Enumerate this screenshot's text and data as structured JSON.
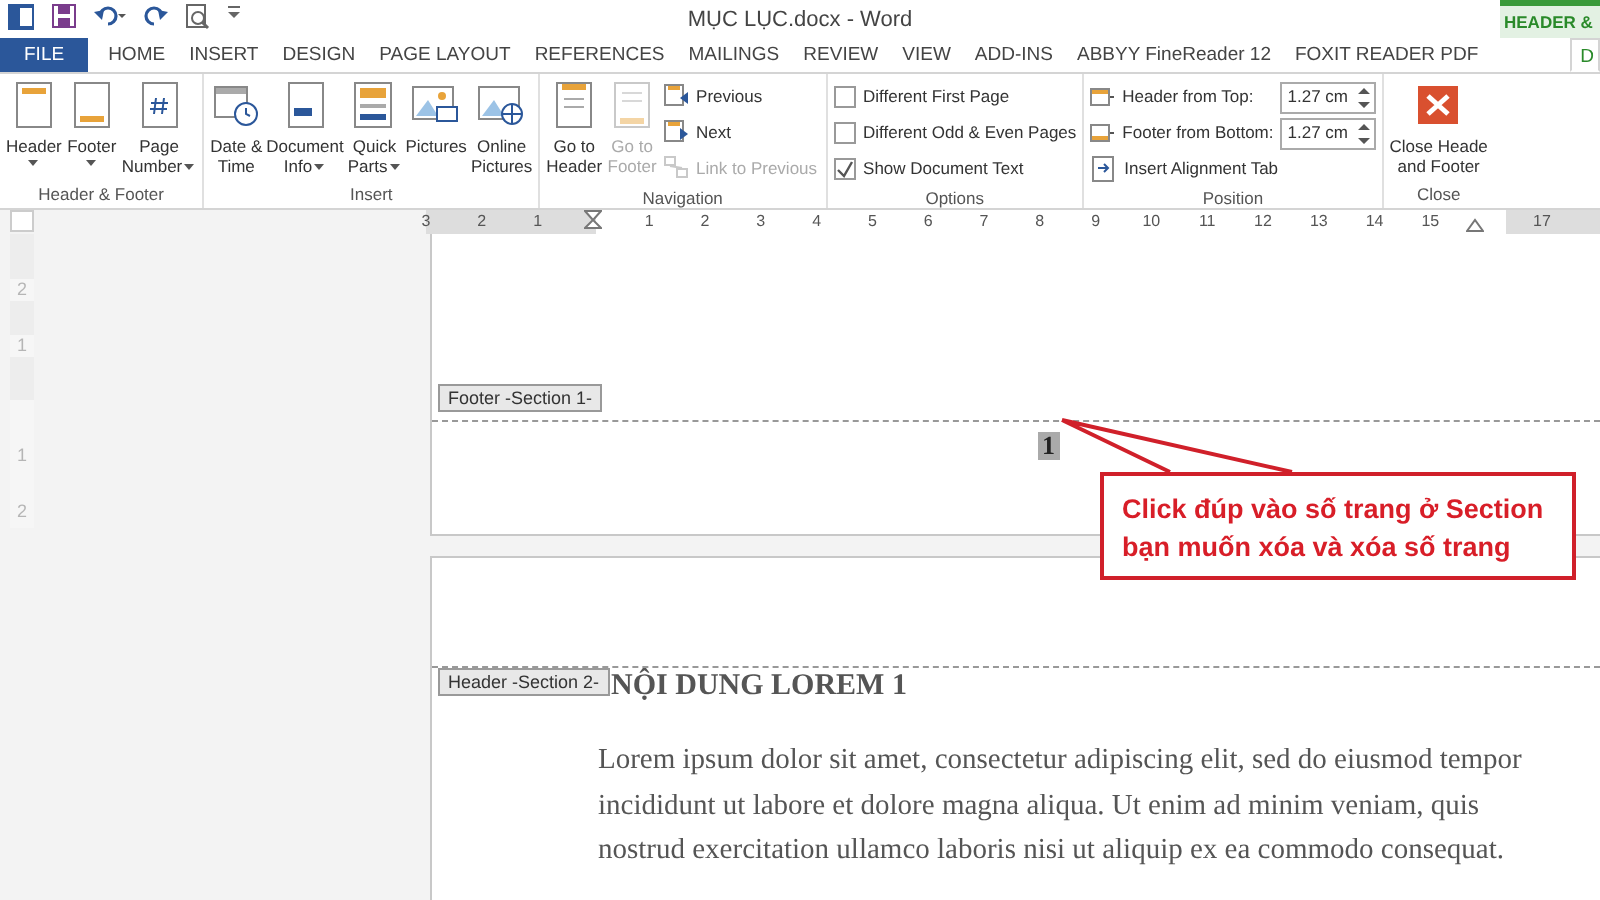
{
  "title_bar": {
    "title": "MỤC LỤC.docx - Word",
    "context_label": "HEADER &"
  },
  "tabs": [
    {
      "label": "FILE",
      "kind": "file",
      "selected": false
    },
    {
      "label": "HOME",
      "kind": "plain",
      "selected": false
    },
    {
      "label": "INSERT",
      "kind": "plain",
      "selected": false
    },
    {
      "label": "DESIGN",
      "kind": "plain",
      "selected": false
    },
    {
      "label": "PAGE LAYOUT",
      "kind": "plain",
      "selected": false
    },
    {
      "label": "REFERENCES",
      "kind": "plain",
      "selected": false
    },
    {
      "label": "MAILINGS",
      "kind": "plain",
      "selected": false
    },
    {
      "label": "REVIEW",
      "kind": "plain",
      "selected": false
    },
    {
      "label": "VIEW",
      "kind": "plain",
      "selected": false
    },
    {
      "label": "ADD-INS",
      "kind": "plain",
      "selected": false
    },
    {
      "label": "ABBYY FineReader 12",
      "kind": "plain",
      "selected": false
    },
    {
      "label": "FOXIT READER PDF",
      "kind": "plain",
      "selected": false
    },
    {
      "label": "D",
      "kind": "context",
      "selected": true
    }
  ],
  "ribbon": [
    {
      "label": "Header & Footer",
      "items": [
        {
          "kind": "large",
          "lines": [
            "Header"
          ],
          "dropdown": true,
          "disabled": false
        },
        {
          "kind": "large",
          "lines": [
            "Footer"
          ],
          "dropdown": true,
          "disabled": false
        },
        {
          "kind": "large",
          "lines": [
            "Page",
            "Number"
          ],
          "dropdown": true,
          "disabled": false
        }
      ]
    },
    {
      "label": "Insert",
      "items": [
        {
          "kind": "large",
          "lines": [
            "Date &",
            "Time"
          ],
          "dropdown": false,
          "disabled": false
        },
        {
          "kind": "large",
          "lines": [
            "Document",
            "Info"
          ],
          "dropdown": true,
          "disabled": false
        },
        {
          "kind": "large",
          "lines": [
            "Quick",
            "Parts"
          ],
          "dropdown": true,
          "disabled": false
        },
        {
          "kind": "large",
          "lines": [
            "Pictures"
          ],
          "dropdown": false,
          "disabled": false
        },
        {
          "kind": "large",
          "lines": [
            "Online",
            "Pictures"
          ],
          "dropdown": false,
          "disabled": false
        }
      ]
    },
    {
      "label": "Navigation",
      "items": [
        {
          "kind": "large",
          "lines": [
            "Go to",
            "Header"
          ],
          "dropdown": false,
          "disabled": false
        },
        {
          "kind": "large",
          "lines": [
            "Go to",
            "Footer"
          ],
          "dropdown": false,
          "disabled": true
        },
        {
          "kind": "small",
          "label": "Previous",
          "disabled": false
        },
        {
          "kind": "small",
          "label": "Next",
          "disabled": false
        },
        {
          "kind": "small",
          "label": "Link to Previous",
          "disabled": true
        }
      ]
    },
    {
      "label": "Options",
      "items": [
        {
          "kind": "check",
          "label": "Different First Page",
          "checked": false
        },
        {
          "kind": "check",
          "label": "Different Odd & Even Pages",
          "checked": false
        },
        {
          "kind": "check",
          "label": "Show Document Text",
          "checked": true
        }
      ]
    },
    {
      "label": "Position",
      "items": [
        {
          "kind": "spin",
          "label": "Header from Top:",
          "value": "1.27 cm"
        },
        {
          "kind": "spin",
          "label": "Footer from Bottom:",
          "value": "1.27 cm"
        },
        {
          "kind": "small",
          "label": "Insert Alignment Tab",
          "disabled": false
        }
      ]
    },
    {
      "label": "Close",
      "items": [
        {
          "kind": "large",
          "lines": [
            "Close Heade",
            "and Footer"
          ],
          "dropdown": false,
          "disabled": false
        }
      ]
    }
  ],
  "ruler": {
    "horizontal": [
      {
        "kind": "number",
        "label": "3"
      },
      {
        "kind": "number",
        "label": "2"
      },
      {
        "kind": "number",
        "label": "1"
      },
      {
        "kind": "indent"
      },
      {
        "kind": "number",
        "label": "1"
      },
      {
        "kind": "number",
        "label": "2"
      },
      {
        "kind": "number",
        "label": "3"
      },
      {
        "kind": "number",
        "label": "4"
      },
      {
        "kind": "number",
        "label": "5"
      },
      {
        "kind": "number",
        "label": "6"
      },
      {
        "kind": "number",
        "label": "7"
      },
      {
        "kind": "number",
        "label": "8"
      },
      {
        "kind": "number",
        "label": "9"
      },
      {
        "kind": "number",
        "label": "10"
      },
      {
        "kind": "number",
        "label": "11"
      },
      {
        "kind": "number",
        "label": "12"
      },
      {
        "kind": "number",
        "label": "13"
      },
      {
        "kind": "number",
        "label": "14"
      },
      {
        "kind": "number",
        "label": "15"
      },
      {
        "kind": "right-indent"
      },
      {
        "kind": "number",
        "label": "17"
      }
    ],
    "vertical": [
      {
        "kind": "number",
        "label": "2"
      },
      {
        "kind": "number",
        "label": "1"
      },
      {
        "kind": "margin"
      },
      {
        "kind": "number",
        "label": "1"
      },
      {
        "kind": "number",
        "label": "2"
      }
    ]
  },
  "document": {
    "footer_tag": "Footer -Section 1-",
    "page_number": "1",
    "header_tag": "Header -Section 2-",
    "heading": "NỘI DUNG LOREM 1",
    "body_lines": [
      "Lorem ipsum dolor sit amet, consectetur adipiscing elit, sed do eiusmod tempor",
      "incididunt ut labore et dolore magna aliqua. Ut enim ad minim veniam, quis",
      "nostrud exercitation ullamco laboris nisi ut aliquip ex ea commodo consequat."
    ]
  },
  "callout": {
    "text": "Click đúp vào số trang ở Section bạn muốn xóa và xóa số trang"
  }
}
